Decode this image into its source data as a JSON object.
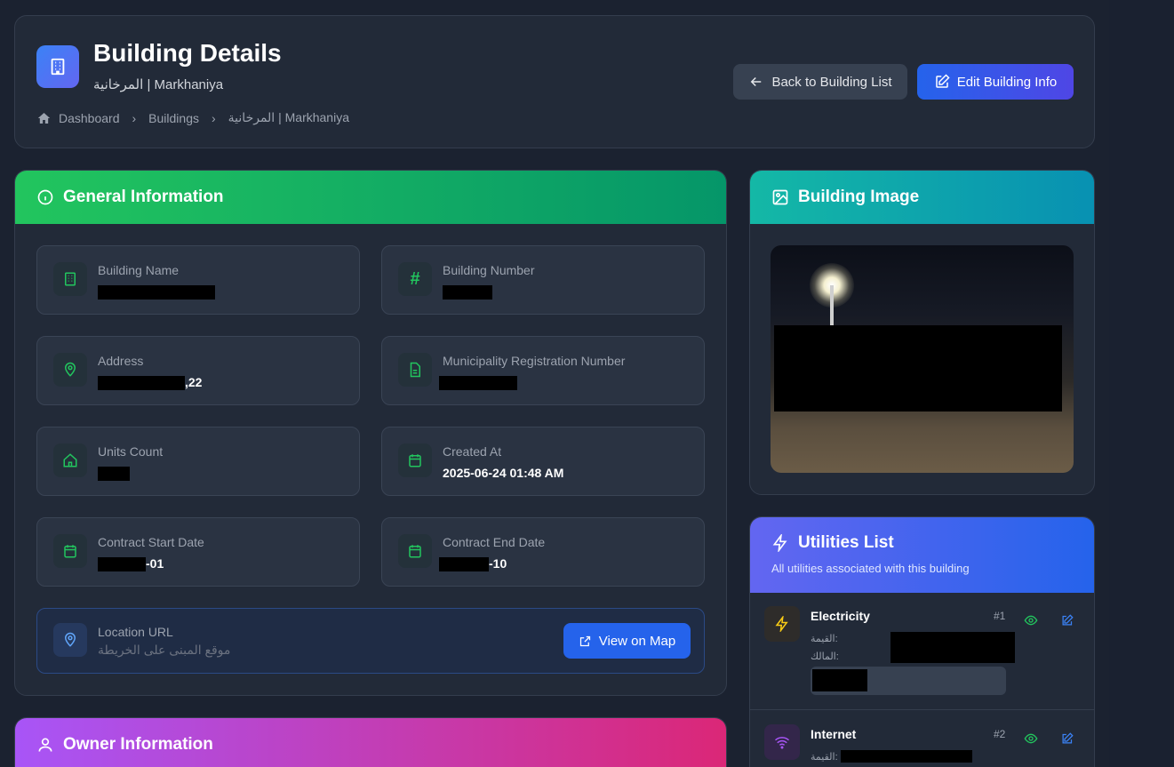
{
  "header": {
    "title": "Building Details",
    "subtitle": "المرخانية | Markhaniya",
    "breadcrumb": [
      "Dashboard",
      "Buildings",
      "المرخانية | Markhaniya"
    ],
    "back_label": "Back to Building List",
    "edit_label": "Edit Building Info"
  },
  "general": {
    "title": "General Information",
    "fields": {
      "building_name": {
        "label": "Building Name",
        "value": ""
      },
      "building_number": {
        "label": "Building Number",
        "value": ""
      },
      "address": {
        "label": "Address",
        "value": ",22"
      },
      "municipality": {
        "label": "Municipality Registration Number",
        "value": ""
      },
      "units": {
        "label": "Units Count",
        "value": ""
      },
      "created": {
        "label": "Created At",
        "value": "2025-06-24 01:48 AM"
      },
      "contract_start": {
        "label": "Contract Start Date",
        "value": "-01"
      },
      "contract_end": {
        "label": "Contract End Date",
        "value": "-10"
      }
    },
    "location": {
      "label": "Location URL",
      "value": "موقع المبنى على الخريطة",
      "button": "View on Map"
    }
  },
  "owner": {
    "title": "Owner Information"
  },
  "image": {
    "title": "Building Image"
  },
  "utilities": {
    "title": "Utilities List",
    "subtitle": "All utilities associated with this building",
    "items": [
      {
        "name": "Electricity",
        "num": "#1",
        "value_label": "القيمة:",
        "owner_label": "المالك:"
      },
      {
        "name": "Internet",
        "num": "#2",
        "value_label": "القيمة:"
      }
    ]
  },
  "colors": {
    "accent": "#2563eb",
    "green": "#22c55e",
    "teal": "#14b8a6",
    "purple": "#a855f7"
  }
}
